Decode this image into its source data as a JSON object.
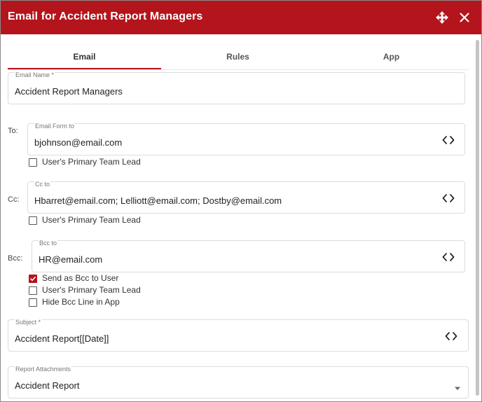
{
  "window": {
    "title": "Email for Accident Report Managers"
  },
  "tabs": [
    {
      "label": "Email"
    },
    {
      "label": "Rules"
    },
    {
      "label": "App"
    }
  ],
  "email_name": {
    "label": "Email Name *",
    "value": "Accident Report Managers"
  },
  "to": {
    "side_label": "To:",
    "field_label": "Email Form to",
    "value": "bjohnson@email.com",
    "checkbox_primary_team_lead": {
      "label": "User's Primary Team Lead",
      "checked": false
    }
  },
  "cc": {
    "side_label": "Cc:",
    "field_label": "Cc to",
    "value": "Hbarret@email.com; Lelliott@email.com; Dostby@email.com",
    "checkbox_primary_team_lead": {
      "label": "User's Primary Team Lead",
      "checked": false
    }
  },
  "bcc": {
    "side_label": "Bcc:",
    "field_label": "Bcc to",
    "value": "HR@email.com",
    "checkbox_send_as_bcc": {
      "label": "Send as Bcc to User",
      "checked": true
    },
    "checkbox_primary_team_lead": {
      "label": "User's Primary Team Lead",
      "checked": false
    },
    "checkbox_hide_bcc_line": {
      "label": "Hide Bcc Line in App",
      "checked": false
    }
  },
  "subject": {
    "label": "Subject *",
    "value": "Accident Report[[Date]]"
  },
  "report_attachments": {
    "label": "Report Attachments",
    "value": "Accident Report"
  },
  "colors": {
    "accent": "#b4141b",
    "border": "#dcdcdc"
  },
  "icons": {
    "move": "move-arrows-icon",
    "close": "close-icon",
    "code": "code-brackets-icon",
    "dropdown": "caret-down-icon"
  }
}
